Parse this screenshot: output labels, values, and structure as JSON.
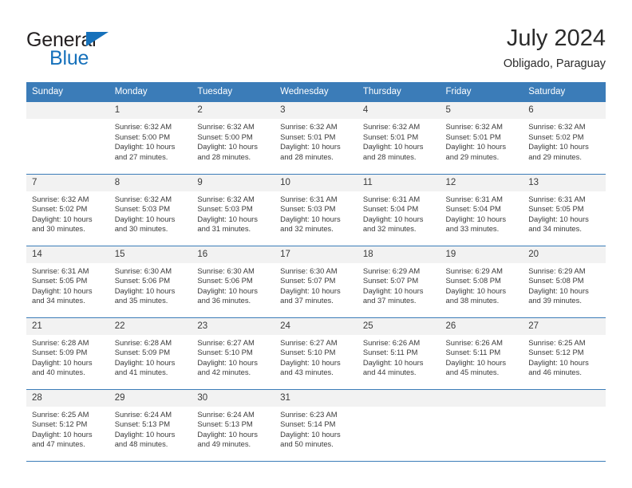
{
  "brand": {
    "name_part1": "General",
    "name_part2": "Blue",
    "triangle_color": "#1671bb",
    "text_color": "#231f20"
  },
  "header": {
    "title": "July 2024",
    "subtitle": "Obligado, Paraguay",
    "accent_color": "#3b7cb8",
    "daynum_bg": "#f2f2f2"
  },
  "weekdays": [
    "Sunday",
    "Monday",
    "Tuesday",
    "Wednesday",
    "Thursday",
    "Friday",
    "Saturday"
  ],
  "weeks": [
    [
      {
        "day": "",
        "blank": true,
        "sunrise": "",
        "sunset": "",
        "daylight1": "",
        "daylight2": ""
      },
      {
        "day": "1",
        "sunrise": "Sunrise: 6:32 AM",
        "sunset": "Sunset: 5:00 PM",
        "daylight1": "Daylight: 10 hours",
        "daylight2": "and 27 minutes."
      },
      {
        "day": "2",
        "sunrise": "Sunrise: 6:32 AM",
        "sunset": "Sunset: 5:00 PM",
        "daylight1": "Daylight: 10 hours",
        "daylight2": "and 28 minutes."
      },
      {
        "day": "3",
        "sunrise": "Sunrise: 6:32 AM",
        "sunset": "Sunset: 5:01 PM",
        "daylight1": "Daylight: 10 hours",
        "daylight2": "and 28 minutes."
      },
      {
        "day": "4",
        "sunrise": "Sunrise: 6:32 AM",
        "sunset": "Sunset: 5:01 PM",
        "daylight1": "Daylight: 10 hours",
        "daylight2": "and 28 minutes."
      },
      {
        "day": "5",
        "sunrise": "Sunrise: 6:32 AM",
        "sunset": "Sunset: 5:01 PM",
        "daylight1": "Daylight: 10 hours",
        "daylight2": "and 29 minutes."
      },
      {
        "day": "6",
        "sunrise": "Sunrise: 6:32 AM",
        "sunset": "Sunset: 5:02 PM",
        "daylight1": "Daylight: 10 hours",
        "daylight2": "and 29 minutes."
      }
    ],
    [
      {
        "day": "7",
        "sunrise": "Sunrise: 6:32 AM",
        "sunset": "Sunset: 5:02 PM",
        "daylight1": "Daylight: 10 hours",
        "daylight2": "and 30 minutes."
      },
      {
        "day": "8",
        "sunrise": "Sunrise: 6:32 AM",
        "sunset": "Sunset: 5:03 PM",
        "daylight1": "Daylight: 10 hours",
        "daylight2": "and 30 minutes."
      },
      {
        "day": "9",
        "sunrise": "Sunrise: 6:32 AM",
        "sunset": "Sunset: 5:03 PM",
        "daylight1": "Daylight: 10 hours",
        "daylight2": "and 31 minutes."
      },
      {
        "day": "10",
        "sunrise": "Sunrise: 6:31 AM",
        "sunset": "Sunset: 5:03 PM",
        "daylight1": "Daylight: 10 hours",
        "daylight2": "and 32 minutes."
      },
      {
        "day": "11",
        "sunrise": "Sunrise: 6:31 AM",
        "sunset": "Sunset: 5:04 PM",
        "daylight1": "Daylight: 10 hours",
        "daylight2": "and 32 minutes."
      },
      {
        "day": "12",
        "sunrise": "Sunrise: 6:31 AM",
        "sunset": "Sunset: 5:04 PM",
        "daylight1": "Daylight: 10 hours",
        "daylight2": "and 33 minutes."
      },
      {
        "day": "13",
        "sunrise": "Sunrise: 6:31 AM",
        "sunset": "Sunset: 5:05 PM",
        "daylight1": "Daylight: 10 hours",
        "daylight2": "and 34 minutes."
      }
    ],
    [
      {
        "day": "14",
        "sunrise": "Sunrise: 6:31 AM",
        "sunset": "Sunset: 5:05 PM",
        "daylight1": "Daylight: 10 hours",
        "daylight2": "and 34 minutes."
      },
      {
        "day": "15",
        "sunrise": "Sunrise: 6:30 AM",
        "sunset": "Sunset: 5:06 PM",
        "daylight1": "Daylight: 10 hours",
        "daylight2": "and 35 minutes."
      },
      {
        "day": "16",
        "sunrise": "Sunrise: 6:30 AM",
        "sunset": "Sunset: 5:06 PM",
        "daylight1": "Daylight: 10 hours",
        "daylight2": "and 36 minutes."
      },
      {
        "day": "17",
        "sunrise": "Sunrise: 6:30 AM",
        "sunset": "Sunset: 5:07 PM",
        "daylight1": "Daylight: 10 hours",
        "daylight2": "and 37 minutes."
      },
      {
        "day": "18",
        "sunrise": "Sunrise: 6:29 AM",
        "sunset": "Sunset: 5:07 PM",
        "daylight1": "Daylight: 10 hours",
        "daylight2": "and 37 minutes."
      },
      {
        "day": "19",
        "sunrise": "Sunrise: 6:29 AM",
        "sunset": "Sunset: 5:08 PM",
        "daylight1": "Daylight: 10 hours",
        "daylight2": "and 38 minutes."
      },
      {
        "day": "20",
        "sunrise": "Sunrise: 6:29 AM",
        "sunset": "Sunset: 5:08 PM",
        "daylight1": "Daylight: 10 hours",
        "daylight2": "and 39 minutes."
      }
    ],
    [
      {
        "day": "21",
        "sunrise": "Sunrise: 6:28 AM",
        "sunset": "Sunset: 5:09 PM",
        "daylight1": "Daylight: 10 hours",
        "daylight2": "and 40 minutes."
      },
      {
        "day": "22",
        "sunrise": "Sunrise: 6:28 AM",
        "sunset": "Sunset: 5:09 PM",
        "daylight1": "Daylight: 10 hours",
        "daylight2": "and 41 minutes."
      },
      {
        "day": "23",
        "sunrise": "Sunrise: 6:27 AM",
        "sunset": "Sunset: 5:10 PM",
        "daylight1": "Daylight: 10 hours",
        "daylight2": "and 42 minutes."
      },
      {
        "day": "24",
        "sunrise": "Sunrise: 6:27 AM",
        "sunset": "Sunset: 5:10 PM",
        "daylight1": "Daylight: 10 hours",
        "daylight2": "and 43 minutes."
      },
      {
        "day": "25",
        "sunrise": "Sunrise: 6:26 AM",
        "sunset": "Sunset: 5:11 PM",
        "daylight1": "Daylight: 10 hours",
        "daylight2": "and 44 minutes."
      },
      {
        "day": "26",
        "sunrise": "Sunrise: 6:26 AM",
        "sunset": "Sunset: 5:11 PM",
        "daylight1": "Daylight: 10 hours",
        "daylight2": "and 45 minutes."
      },
      {
        "day": "27",
        "sunrise": "Sunrise: 6:25 AM",
        "sunset": "Sunset: 5:12 PM",
        "daylight1": "Daylight: 10 hours",
        "daylight2": "and 46 minutes."
      }
    ],
    [
      {
        "day": "28",
        "sunrise": "Sunrise: 6:25 AM",
        "sunset": "Sunset: 5:12 PM",
        "daylight1": "Daylight: 10 hours",
        "daylight2": "and 47 minutes."
      },
      {
        "day": "29",
        "sunrise": "Sunrise: 6:24 AM",
        "sunset": "Sunset: 5:13 PM",
        "daylight1": "Daylight: 10 hours",
        "daylight2": "and 48 minutes."
      },
      {
        "day": "30",
        "sunrise": "Sunrise: 6:24 AM",
        "sunset": "Sunset: 5:13 PM",
        "daylight1": "Daylight: 10 hours",
        "daylight2": "and 49 minutes."
      },
      {
        "day": "31",
        "sunrise": "Sunrise: 6:23 AM",
        "sunset": "Sunset: 5:14 PM",
        "daylight1": "Daylight: 10 hours",
        "daylight2": "and 50 minutes."
      },
      {
        "day": "",
        "blank": true,
        "sunrise": "",
        "sunset": "",
        "daylight1": "",
        "daylight2": ""
      },
      {
        "day": "",
        "blank": true,
        "sunrise": "",
        "sunset": "",
        "daylight1": "",
        "daylight2": ""
      },
      {
        "day": "",
        "blank": true,
        "sunrise": "",
        "sunset": "",
        "daylight1": "",
        "daylight2": ""
      }
    ]
  ]
}
